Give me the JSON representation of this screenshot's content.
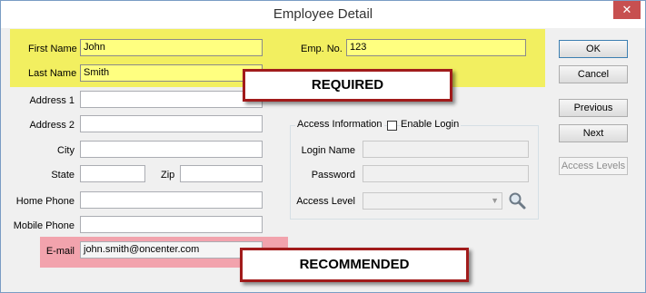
{
  "window": {
    "title": "Employee Detail",
    "close_glyph": "✕"
  },
  "required": {
    "callout": "REQUIRED",
    "color": "#f2ef60"
  },
  "recommended": {
    "callout": "RECOMMENDED",
    "color": "#f2a3ad"
  },
  "fields": {
    "first_name": {
      "label": "First Name",
      "value": "John"
    },
    "last_name": {
      "label": "Last Name",
      "value": "Smith"
    },
    "emp_no": {
      "label": "Emp. No.",
      "value": "123"
    },
    "address1": {
      "label": "Address 1",
      "value": ""
    },
    "address2": {
      "label": "Address 2",
      "value": ""
    },
    "city": {
      "label": "City",
      "value": ""
    },
    "state": {
      "label": "State",
      "value": ""
    },
    "zip": {
      "label": "Zip",
      "value": ""
    },
    "home_phone": {
      "label": "Home Phone",
      "value": ""
    },
    "mobile_phone": {
      "label": "Mobile Phone",
      "value": ""
    },
    "email": {
      "label": "E-mail",
      "value": "john.smith@oncenter.com"
    }
  },
  "access": {
    "group_label": "Access Information",
    "enable_login_label": "Enable Login",
    "enable_login_checked": false,
    "login_name_label": "Login Name",
    "password_label": "Password",
    "access_level_label": "Access Level",
    "access_level_value": ""
  },
  "buttons": {
    "ok": "OK",
    "cancel": "Cancel",
    "previous": "Previous",
    "next": "Next",
    "access_levels": "Access Levels"
  }
}
